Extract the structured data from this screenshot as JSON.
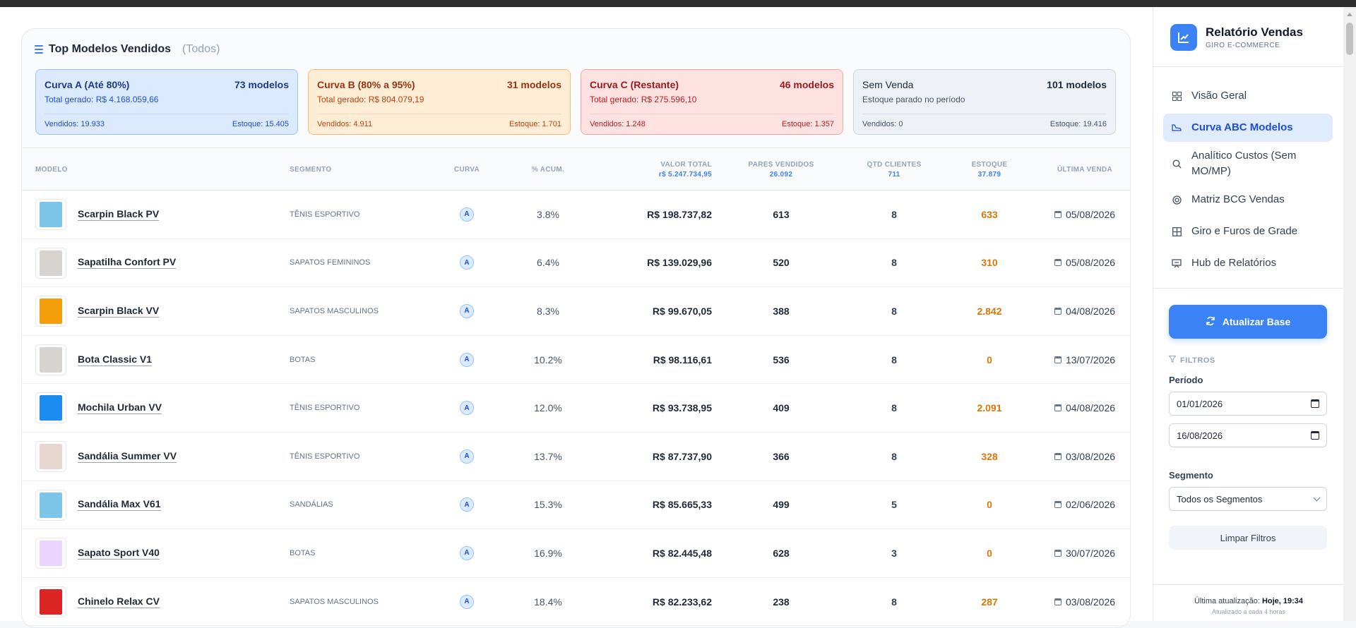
{
  "header": {
    "title": "Top Modelos Vendidos",
    "subtitle": "(Todos)"
  },
  "curves": [
    {
      "name": "Curva A (Até 80%)",
      "count": "73 modelos",
      "total": "Total gerado: R$ 4.168.059,66",
      "vendidos": "Vendidos: 19.933",
      "estoque": "Estoque: 15.405"
    },
    {
      "name": "Curva B (80% a 95%)",
      "count": "31 modelos",
      "total": "Total gerado: R$ 804.079,19",
      "vendidos": "Vendidos: 4.911",
      "estoque": "Estoque: 1.701"
    },
    {
      "name": "Curva C (Restante)",
      "count": "46 modelos",
      "total": "Total gerado: R$ 275.596,10",
      "vendidos": "Vendidos: 1.248",
      "estoque": "Estoque: 1.357"
    },
    {
      "name": "Sem Venda",
      "count": "101 modelos",
      "total": "Estoque parado no período",
      "vendidos": "Vendidos: 0",
      "estoque": "Estoque: 19.416"
    }
  ],
  "table": {
    "headers": {
      "modelo": "MODELO",
      "segmento": "SEGMENTO",
      "curva": "CURVA",
      "acum": "% ACUM.",
      "valor": "VALOR TOTAL",
      "valor_sub": "r$ 5.247.734,95",
      "pares": "PARES VENDIDOS",
      "pares_sub": "26.092",
      "qtd": "QTD CLIENTES",
      "qtd_sub": "711",
      "estoque": "ESTOQUE",
      "estoque_sub": "37.879",
      "ultima": "ÚLTIMA VENDA"
    },
    "rows": [
      {
        "model": "Scarpin Black PV",
        "segment": "TÊNIS ESPORTIVO",
        "curve": "A",
        "acum": "3.8%",
        "valor": "R$ 198.737,82",
        "pares": "613",
        "qtd": "8",
        "estoque": "633",
        "ultima": "05/08/2026",
        "thumb": "#7cc4e8"
      },
      {
        "model": "Sapatilha Confort PV",
        "segment": "SAPATOS FEMININOS",
        "curve": "A",
        "acum": "6.4%",
        "valor": "R$ 139.029,96",
        "pares": "520",
        "qtd": "8",
        "estoque": "310",
        "ultima": "05/08/2026",
        "thumb": "#d6d3d1"
      },
      {
        "model": "Scarpin Black VV",
        "segment": "SAPATOS MASCULINOS",
        "curve": "A",
        "acum": "8.3%",
        "valor": "R$ 99.670,05",
        "pares": "388",
        "qtd": "8",
        "estoque": "2.842",
        "ultima": "04/08/2026",
        "thumb": "#f59e0b"
      },
      {
        "model": "Bota Classic V1",
        "segment": "BOTAS",
        "curve": "A",
        "acum": "10.2%",
        "valor": "R$ 98.116,61",
        "pares": "536",
        "qtd": "8",
        "estoque": "0",
        "ultima": "13/07/2026",
        "thumb": "#d6d3d1"
      },
      {
        "model": "Mochila Urban VV",
        "segment": "TÊNIS ESPORTIVO",
        "curve": "A",
        "acum": "12.0%",
        "valor": "R$ 93.738,95",
        "pares": "409",
        "qtd": "8",
        "estoque": "2.091",
        "ultima": "04/08/2026",
        "thumb": "#1d8cf0"
      },
      {
        "model": "Sandália Summer VV",
        "segment": "TÊNIS ESPORTIVO",
        "curve": "A",
        "acum": "13.7%",
        "valor": "R$ 87.737,90",
        "pares": "366",
        "qtd": "8",
        "estoque": "328",
        "ultima": "03/08/2026",
        "thumb": "#e7d5cf"
      },
      {
        "model": "Sandália Max V61",
        "segment": "SANDÁLIAS",
        "curve": "A",
        "acum": "15.3%",
        "valor": "R$ 85.665,33",
        "pares": "499",
        "qtd": "5",
        "estoque": "0",
        "ultima": "02/06/2026",
        "thumb": "#7cc4e8"
      },
      {
        "model": "Sapato Sport V40",
        "segment": "BOTAS",
        "curve": "A",
        "acum": "16.9%",
        "valor": "R$ 82.445,48",
        "pares": "628",
        "qtd": "3",
        "estoque": "0",
        "ultima": "30/07/2026",
        "thumb": "#e9d5ff"
      },
      {
        "model": "Chinelo Relax CV",
        "segment": "SAPATOS MASCULINOS",
        "curve": "A",
        "acum": "18.4%",
        "valor": "R$ 82.233,62",
        "pares": "238",
        "qtd": "8",
        "estoque": "287",
        "ultima": "03/08/2026",
        "thumb": "#dc2626"
      }
    ]
  },
  "sidebar": {
    "title": "Relatório Vendas",
    "subtitle": "GIRO E-COMMERCE",
    "nav": [
      {
        "label": "Visão Geral",
        "icon": "grid-icon"
      },
      {
        "label": "Curva ABC Modelos",
        "icon": "shoe-icon"
      },
      {
        "label": "Analítico Custos (Sem MO/MP)",
        "icon": "search-icon"
      },
      {
        "label": "Matriz BCG Vendas",
        "icon": "target-icon"
      },
      {
        "label": "Giro e Furos de Grade",
        "icon": "table-icon"
      },
      {
        "label": "Hub de Relatórios",
        "icon": "presentation-icon"
      }
    ],
    "update_button": "Atualizar Base",
    "filters_title": "FILTROS",
    "period_label": "Período",
    "date_start": "01/01/2026",
    "date_end": "16/08/2026",
    "segment_label": "Segmento",
    "segment_value": "Todos os Segmentos",
    "clear_button": "Limpar Filtros",
    "last_update_label": "Última atualização:",
    "last_update_value": "Hoje, 19:34",
    "update_freq": "Atualizado a cada 4 horas"
  },
  "colors": {
    "accent": "#3b82f6",
    "stock": "#d97706"
  }
}
